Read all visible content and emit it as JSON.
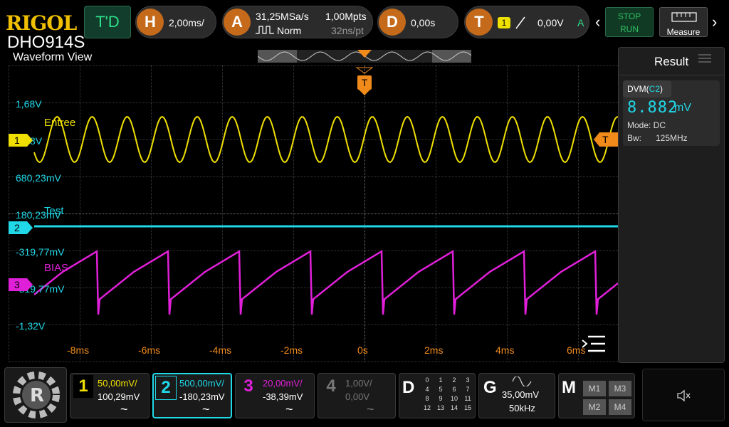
{
  "brand": {
    "logo": "RIGOL",
    "model": "DHO914S"
  },
  "view_title": "Waveform View",
  "top": {
    "td": "T'D",
    "h_letter": "H",
    "h_value": "2,00ms/",
    "a_letter": "A",
    "a_rate": "31,25MSa/s",
    "a_mode": "Norm",
    "a_mpts": "1,00Mpts",
    "a_ns": "32ns/pt",
    "d_letter": "D",
    "d_value": "0,00s",
    "t_letter": "T",
    "t_channel": "1",
    "t_level": "0,00V",
    "t_mode": "A",
    "stop": "STOP",
    "run": "RUN",
    "measure": "Measure"
  },
  "wave": {
    "labels": {
      "y1": "1,68V",
      "y2": "680,23mV",
      "y3": "180,23mV",
      "y4": "-319,77mV",
      "y5": "-819,77mV",
      "y6": "-1,32V",
      "ch1_name": "Entree",
      "ch2_name": "Test",
      "ch3_name": "BIAS",
      "ch1_marker": "1",
      "ch2_marker": "2",
      "ch3_marker": "3",
      "trig_top": "T",
      "trig_right": "T"
    },
    "x_ticks": [
      "-8ms",
      "-6ms",
      "-4ms",
      "-2ms",
      "0s",
      "2ms",
      "4ms",
      "6ms",
      "8ms"
    ]
  },
  "result": {
    "title": "Result",
    "dvm_label": "DVM(",
    "dvm_channel": "C2",
    "dvm_close": ")",
    "value": "8.882",
    "unit": "mV",
    "mode": "Mode: DC",
    "bw_label": "Bw:",
    "bw_value": "125MHz"
  },
  "bottom": {
    "ch1": {
      "num": "1",
      "scale": "50,00mV/",
      "offset": "100,29mV",
      "coupling": "~"
    },
    "ch2": {
      "num": "2",
      "scale": "500,00mV/",
      "offset": "-180,23mV",
      "coupling": "~"
    },
    "ch3": {
      "num": "3",
      "scale": "20,00mV/",
      "offset": "-38,39mV",
      "coupling": "~"
    },
    "ch4": {
      "num": "4",
      "scale": "1,00V/",
      "offset": "0,00V",
      "coupling": "~"
    },
    "d": {
      "letter": "D",
      "grid": [
        "0",
        "1",
        "2",
        "3",
        "4",
        "5",
        "6",
        "7",
        "8",
        "9",
        "10",
        "11",
        "12",
        "13",
        "14",
        "15"
      ]
    },
    "g": {
      "letter": "G",
      "amp": "35,00mV",
      "freq": "50kHz"
    },
    "m": {
      "letter": "M",
      "m1": "M1",
      "m2": "M2",
      "m3": "M3",
      "m4": "M4"
    }
  },
  "colors": {
    "ch1": "#f0e000",
    "ch2": "#20d8e8",
    "ch3": "#e020d8",
    "accent": "#f08a1a"
  }
}
